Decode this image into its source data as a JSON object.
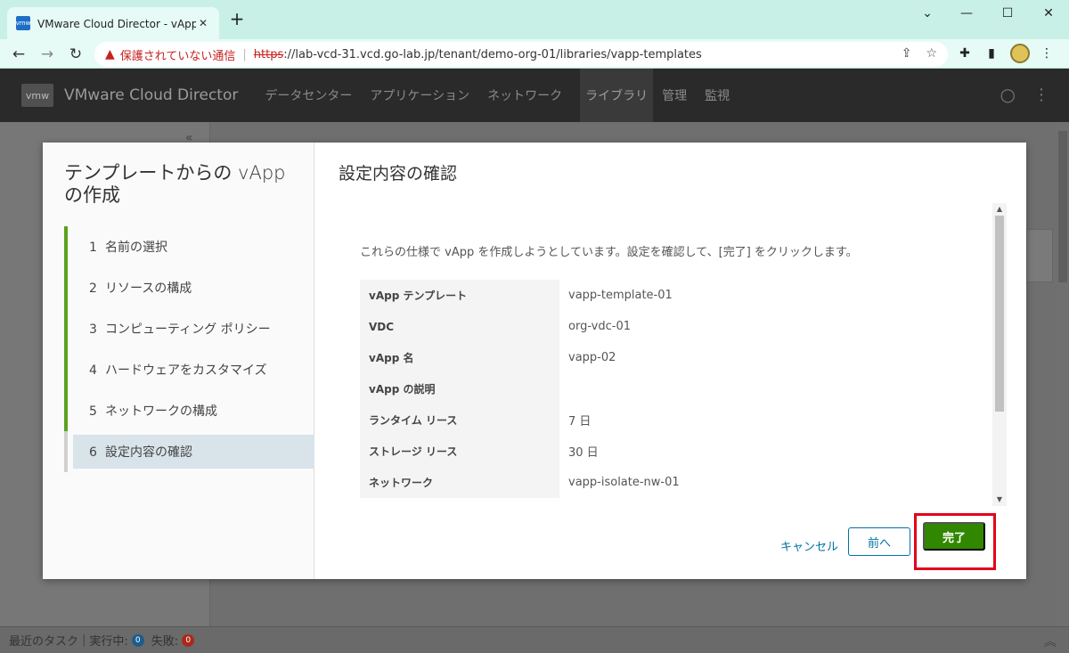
{
  "browser": {
    "tab_title": "VMware Cloud Director - vApp テ",
    "favicon_text": "vmw",
    "new_tab": "+",
    "security_warning": "保護されていない通信",
    "url_scheme": "https",
    "url_rest": "://lab-vcd-31.vcd.go-lab.jp/tenant/demo-org-01/libraries/vapp-templates"
  },
  "app": {
    "logo": "vmw",
    "title": "VMware Cloud Director",
    "nav": [
      "データセンター",
      "アプリケーション",
      "ネットワーク",
      "ライブラリ",
      "管理",
      "監視"
    ],
    "active_nav": "ライブラリ"
  },
  "taskbar": {
    "recent_tasks": "最近のタスク",
    "running_label": "実行中:",
    "running_count": "0",
    "failed_label": "失敗:",
    "failed_count": "0"
  },
  "wizard": {
    "title": "テンプレートからの vApp の作成",
    "steps": [
      {
        "num": "1",
        "label": "名前の選択"
      },
      {
        "num": "2",
        "label": "リソースの構成"
      },
      {
        "num": "3",
        "label": "コンピューティング ポリシー"
      },
      {
        "num": "4",
        "label": "ハードウェアをカスタマイズ"
      },
      {
        "num": "5",
        "label": "ネットワークの構成"
      },
      {
        "num": "6",
        "label": "設定内容の確認"
      }
    ],
    "content_title": "設定内容の確認",
    "intro": "これらの仕様で vApp を作成しようとしています。設定を確認して、[完了] をクリックします。",
    "summary": [
      {
        "key": "vApp テンプレート",
        "value": "vapp-template-01"
      },
      {
        "key": "VDC",
        "value": "org-vdc-01"
      },
      {
        "key": "vApp 名",
        "value": "vapp-02"
      },
      {
        "key": "vApp の説明",
        "value": ""
      },
      {
        "key": "ランタイム リース",
        "value": "7 日"
      },
      {
        "key": "ストレージ リース",
        "value": "30 日"
      },
      {
        "key": "ネットワーク",
        "value": "vapp-isolate-nw-01"
      }
    ],
    "buttons": {
      "cancel": "キャンセル",
      "previous": "前へ",
      "finish": "完了"
    }
  },
  "colors": {
    "accent": "#0072a3",
    "finish_button": "#318700",
    "step_done": "#5aa220",
    "highlight": "#e4001b"
  }
}
